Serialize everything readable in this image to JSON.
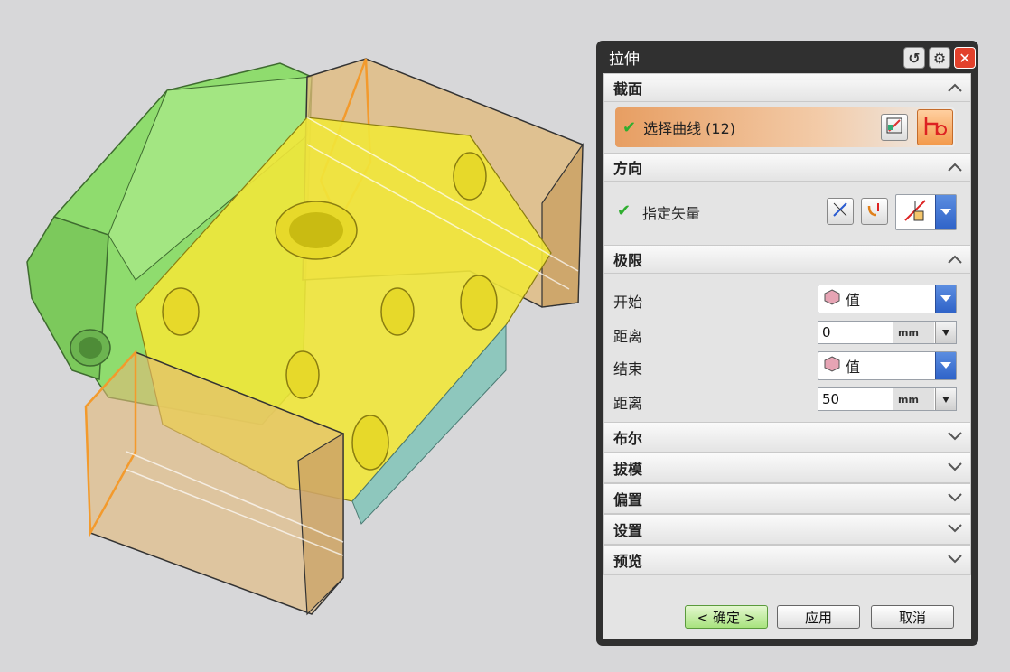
{
  "dialog": {
    "title": "拉伸",
    "sections": {
      "section": {
        "label": "截面",
        "select_curve_label": "选择曲线 (12)"
      },
      "direction": {
        "label": "方向",
        "specify_vector_label": "指定矢量"
      },
      "limits": {
        "label": "极限",
        "start_label": "开始",
        "start_option": "值",
        "start_distance_label": "距离",
        "start_distance": "0",
        "end_label": "结束",
        "end_option": "值",
        "end_distance_label": "距离",
        "end_distance": "50",
        "unit": "mm"
      },
      "collapsed": [
        {
          "label": "布尔"
        },
        {
          "label": "拔模"
        },
        {
          "label": "偏置"
        },
        {
          "label": "设置"
        },
        {
          "label": "预览"
        }
      ]
    },
    "buttons": {
      "ok": "< 确定 >",
      "apply": "应用",
      "cancel": "取消"
    }
  },
  "icons": [
    "reset-icon",
    "settings-icon",
    "close-icon",
    "sketch-section-icon",
    "curve-select-icon",
    "vector-dialog-icon",
    "reverse-direction-icon",
    "vector-type-icon",
    "value-icon",
    "chevron-up-icon",
    "chevron-down-icon",
    "check-icon"
  ],
  "colors": {
    "model_green": "#8fdc6e",
    "model_yellow": "#f1e73a",
    "extrude_body": "#e2b978",
    "extrude_edge": "#f39a2c",
    "section_highlight": "#e79e62",
    "dialog_frame": "#303030",
    "ok_button": "#a8e37e"
  }
}
